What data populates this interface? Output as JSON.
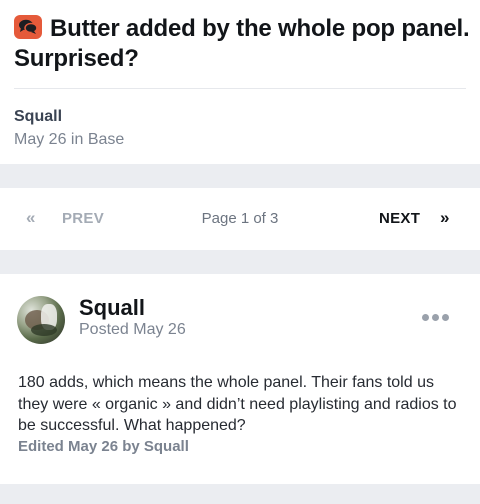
{
  "topic": {
    "title": "Butter added by the whole pop panel. Surprised?",
    "author": "Squall",
    "date": "May 26",
    "in_word": "in",
    "forum": "Base"
  },
  "pagination": {
    "prev_label": "PREV",
    "page_text": "Page 1 of 3",
    "next_label": "NEXT"
  },
  "post": {
    "author": "Squall",
    "posted": "Posted May 26",
    "body": "180 adds, which means the whole panel. Their fans told us they were « organic » and didn’t need playlisting and radios to be successful. What happened?",
    "edited": "Edited May 26 by Squall"
  },
  "icons": {
    "topic_badge": "chat-bubbles-icon",
    "prev": "double-chevron-left-icon",
    "next": "double-chevron-right-icon",
    "more": "ellipsis-icon"
  },
  "colors": {
    "badge": "#e55a3a",
    "background": "#ebedf1",
    "muted_text": "#7b8390"
  }
}
